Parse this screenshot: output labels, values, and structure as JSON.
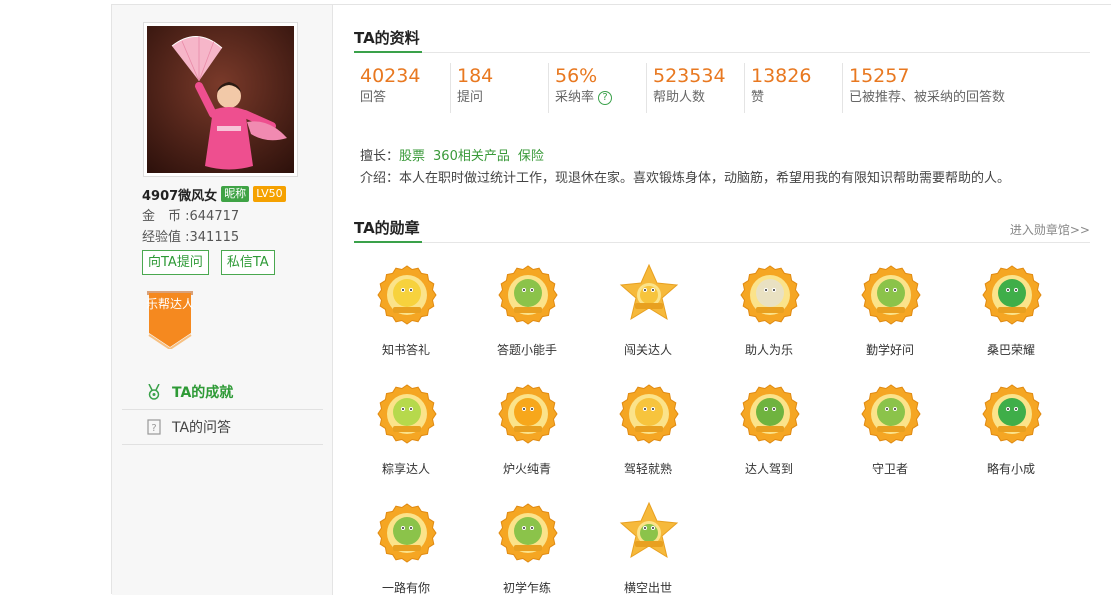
{
  "profile": {
    "username": "4907微风女",
    "nickname_tag": "昵称",
    "level_tag": "LV50",
    "coins_label": "金　币 :",
    "coins_value": "644717",
    "exp_label": "经验值 :",
    "exp_value": "341115",
    "ask_button": "向TA提问",
    "message_button": "私信TA",
    "ribbon_text": "乐帮达人"
  },
  "nav": {
    "achievements": "TA的成就",
    "qa": "TA的问答"
  },
  "info": {
    "title": "TA的资料",
    "stats": [
      {
        "value": "40234",
        "label": "回答"
      },
      {
        "value": "184",
        "label": "提问"
      },
      {
        "value": "56%",
        "label": "采纳率"
      },
      {
        "value": "523534",
        "label": "帮助人数"
      },
      {
        "value": "13826",
        "label": "赞"
      },
      {
        "value": "15257",
        "label": "已被推荐、被采纳的回答数"
      }
    ],
    "skills_label": "擅长：",
    "skills": [
      "股票",
      "360相关产品",
      "保险"
    ],
    "intro_label": "介绍：",
    "intro_text": "本人在职时做过统计工作，现退休在家。喜欢锻炼身体，动脑筋，希望用我的有限知识帮助需要帮助的人。"
  },
  "medals": {
    "title": "TA的勋章",
    "more_link": "进入勋章馆>>",
    "items": [
      {
        "label": "知书答礼",
        "icon": "rabbit-medal-icon"
      },
      {
        "label": "答题小能手",
        "icon": "green-frog-medal-icon"
      },
      {
        "label": "闯关达人",
        "icon": "star-medal-icon"
      },
      {
        "label": "助人为乐",
        "icon": "handshake-medal-icon"
      },
      {
        "label": "勤学好问",
        "icon": "scholar-medal-icon"
      },
      {
        "label": "桑巴荣耀",
        "icon": "soccer-medal-icon"
      },
      {
        "label": "粽享达人",
        "icon": "zongzi-medal-icon"
      },
      {
        "label": "炉火纯青",
        "icon": "lightning-medal-icon"
      },
      {
        "label": "驾轻就熟",
        "icon": "thumbs-up-medal-icon"
      },
      {
        "label": "达人驾到",
        "icon": "chef-medal-icon"
      },
      {
        "label": "守卫者",
        "icon": "guard-medal-icon"
      },
      {
        "label": "略有小成",
        "icon": "green-creature-medal-icon"
      },
      {
        "label": "一路有你",
        "icon": "waving-medal-icon"
      },
      {
        "label": "初学乍练",
        "icon": "glasses-medal-icon"
      },
      {
        "label": "横空出世",
        "icon": "star-creature-medal-icon"
      }
    ]
  },
  "colors": {
    "accent_green": "#3aa14a",
    "stat_orange": "#e87820",
    "medal_gold": "#f5a623"
  }
}
